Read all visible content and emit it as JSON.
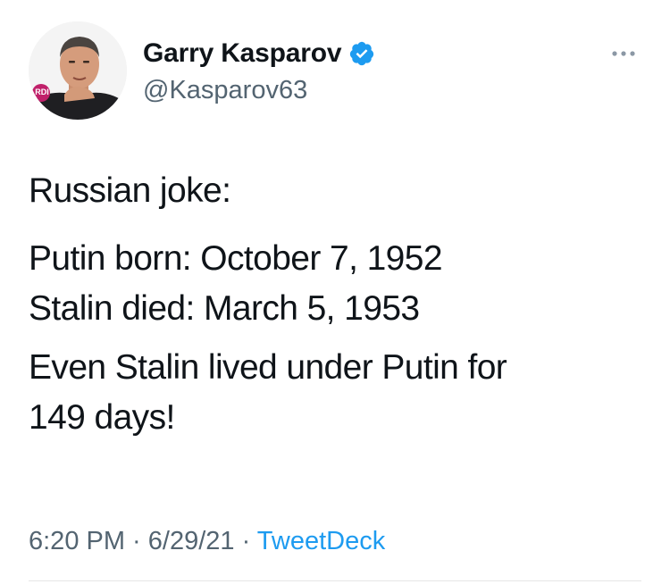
{
  "author": {
    "display_name": "Garry Kasparov",
    "handle": "@Kasparov63",
    "avatar_badge": "RDI",
    "verified_color": "#1d9bf0"
  },
  "icons": {
    "verified": "verified-badge-icon",
    "more": "more-options-icon"
  },
  "tweet": {
    "line1": "Russian joke:",
    "line2": "Putin born: October 7, 1952",
    "line3": "Stalin died: March 5, 1953",
    "line4a": "Even Stalin lived under Putin for",
    "line4b": "149 days!"
  },
  "meta": {
    "time": "6:20 PM",
    "sep1": " · ",
    "date": "6/29/21",
    "sep2": " · ",
    "source": "TweetDeck"
  },
  "colors": {
    "text": "#0f1419",
    "secondary": "#536471",
    "link": "#1d9bf0"
  }
}
